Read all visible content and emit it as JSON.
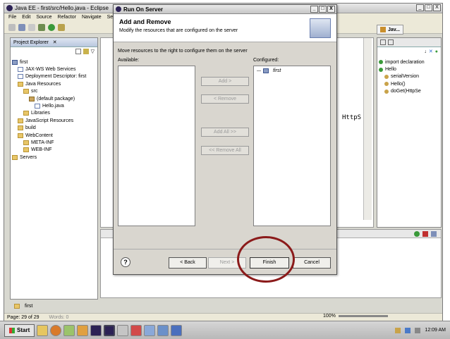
{
  "window": {
    "title": "Java EE - first/src/Hello.java - Eclipse",
    "min": "_",
    "max": "□",
    "close": "X"
  },
  "menu": [
    "File",
    "Edit",
    "Source",
    "Refactor",
    "Navigate",
    "Sear"
  ],
  "perspective_tab": "Jav...",
  "project_explorer": {
    "title": "Project Explorer",
    "tree": [
      {
        "label": "first",
        "level": 0,
        "icon": "project-icon"
      },
      {
        "label": "JAX-WS Web Services",
        "level": 1,
        "icon": "webservice-icon"
      },
      {
        "label": "Deployment Descriptor: first",
        "level": 1,
        "icon": "descriptor-icon"
      },
      {
        "label": "Java Resources",
        "level": 1,
        "icon": "java-resources-icon"
      },
      {
        "label": "src",
        "level": 2,
        "icon": "folder-icon"
      },
      {
        "label": "(default package)",
        "level": 3,
        "icon": "package-icon"
      },
      {
        "label": "Hello.java",
        "level": 4,
        "icon": "java-file-icon"
      },
      {
        "label": "Libraries",
        "level": 2,
        "icon": "library-icon"
      },
      {
        "label": "JavaScript Resources",
        "level": 1,
        "icon": "js-resources-icon"
      },
      {
        "label": "build",
        "level": 1,
        "icon": "folder-icon"
      },
      {
        "label": "WebContent",
        "level": 1,
        "icon": "folder-icon"
      },
      {
        "label": "META-INF",
        "level": 2,
        "icon": "folder-icon"
      },
      {
        "label": "WEB-INF",
        "level": 2,
        "icon": "folder-icon"
      },
      {
        "label": "Servers",
        "level": 0,
        "icon": "servers-icon"
      }
    ]
  },
  "editor": {
    "code_fragment": "HttpS"
  },
  "outline": {
    "items": [
      {
        "label": "import declaration",
        "level": 0
      },
      {
        "label": "Hello",
        "level": 0
      },
      {
        "label": "serialVersion",
        "level": 1
      },
      {
        "label": "Hello()",
        "level": 1
      },
      {
        "label": "doGet(HttpSe",
        "level": 1
      }
    ]
  },
  "bottom_left": {
    "label": "first"
  },
  "status": {
    "text": "Page: 29 of 29",
    "words": "Words: 0"
  },
  "dialog": {
    "title": "Run On Server",
    "heading": "Add and Remove",
    "description": "Modify the resources that are configured on the server",
    "instruction": "Move resources to the right to configure them on the server",
    "available_label": "Available:",
    "configured_label": "Configured:",
    "configured_items": [
      "first"
    ],
    "buttons": {
      "add": "Add >",
      "remove": "< Remove",
      "add_all": "Add All >>",
      "remove_all": "<< Remove All"
    },
    "footer": {
      "help": "?",
      "back": "< Back",
      "next": "Next >",
      "finish": "Finish",
      "cancel": "Cancel"
    }
  },
  "taskbar": {
    "start": "Start",
    "zoom": "100%",
    "clock": "12:09 AM"
  },
  "colors": {
    "highlight_circle": "#8b1a1a",
    "title_gradient": "#c6c6c6"
  }
}
